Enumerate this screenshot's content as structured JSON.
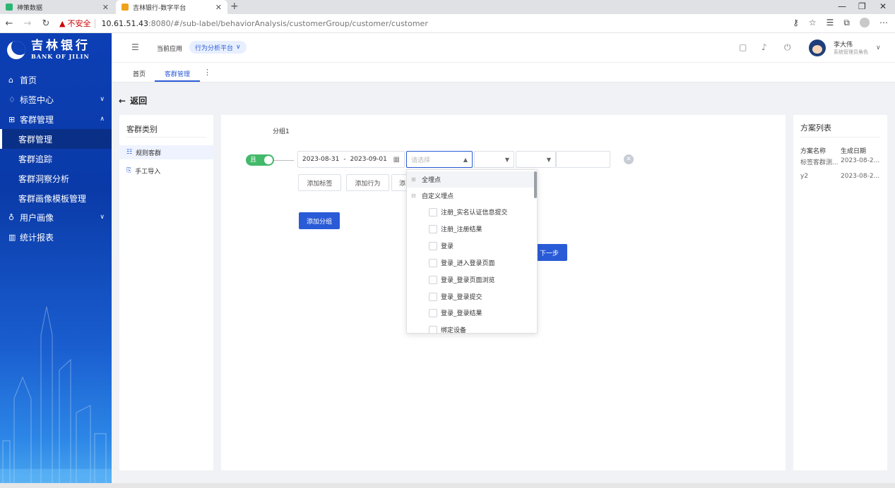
{
  "browser": {
    "tabs": [
      {
        "title": "神策数据",
        "active": false
      },
      {
        "title": "吉林银行-数字平台",
        "active": true
      }
    ],
    "new_tab": "+",
    "insecure_label": "不安全",
    "url_host": "10.61.51.43",
    "url_rest": ":8080/#/sub-label/behaviorAnalysis/customerGroup/customer/customer"
  },
  "brand": {
    "name_cn": "吉林银行",
    "name_en": "BANK OF JILIN"
  },
  "sidebar": {
    "items": [
      {
        "label": "首页",
        "icon": "home-icon",
        "glyph": "⌂"
      },
      {
        "label": "标签中心",
        "icon": "tag-icon",
        "glyph": "♢",
        "chevron": "∨"
      },
      {
        "label": "客群管理",
        "icon": "group-icon",
        "glyph": "⊞",
        "chevron": "∧"
      },
      {
        "label": "用户画像",
        "icon": "user-icon",
        "glyph": "♁",
        "chevron": "∨"
      },
      {
        "label": "统计报表",
        "icon": "chart-icon",
        "glyph": "▥"
      }
    ],
    "sub_items": [
      {
        "label": "客群管理",
        "active": true
      },
      {
        "label": "客群追踪",
        "active": false
      },
      {
        "label": "客群洞察分析",
        "active": false
      },
      {
        "label": "客群画像模板管理",
        "active": false
      }
    ]
  },
  "header": {
    "current_app_label": "当前应用",
    "app_select": "行为分析平台",
    "user_name": "李大伟",
    "user_role": "系统管理员角色"
  },
  "page_tabs": [
    {
      "label": "首页",
      "active": false
    },
    {
      "label": "客群管理",
      "active": true
    }
  ],
  "back_label": "返回",
  "left_panel": {
    "title": "客群类别",
    "items": [
      {
        "label": "规则客群",
        "icon": "rule-icon",
        "glyph": "☷",
        "selected": true
      },
      {
        "label": "手工导入",
        "icon": "import-icon",
        "glyph": "⎘",
        "selected": false
      }
    ]
  },
  "group": {
    "label": "分组1",
    "toggle_text": "且",
    "date_start": "2023-08-31",
    "date_sep": "-",
    "date_end": "2023-09-01",
    "select_placeholder": "请选择",
    "buttons": [
      "添加标签",
      "添加行为",
      "添"
    ],
    "add_group": "添加分组",
    "next": "下一步"
  },
  "dropdown": {
    "all_points": "全埋点",
    "custom_points": "自定义埋点",
    "options": [
      "注册_实名认证信息提交",
      "注册_注册结果",
      "登录",
      "登录_进入登录页面",
      "登录_登录页面浏览",
      "登录_登录提交",
      "登录_登录结果",
      "绑定设备"
    ]
  },
  "right_panel": {
    "title": "方案列表",
    "columns": [
      "方案名称",
      "生成日期"
    ],
    "rows": [
      [
        "标签客群测...",
        "2023-08-2..."
      ],
      [
        "y2",
        "2023-08-2..."
      ]
    ]
  },
  "colors": {
    "primary": "#2a5bd7",
    "toggle": "#43b96a",
    "sidebar": "#0d3fb5"
  }
}
